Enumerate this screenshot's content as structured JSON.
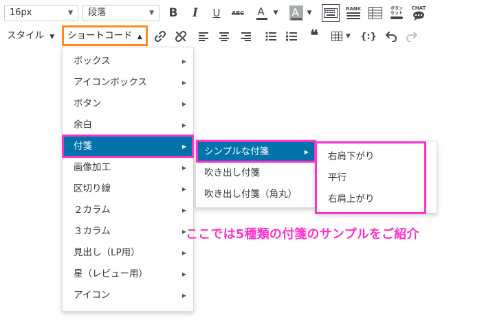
{
  "toolbar": {
    "font_size_select": "16px",
    "block_format_select": "段落",
    "styles_label": "スタイル",
    "shortcode_label": "ショートコード",
    "buttons": {
      "bold": "B",
      "italic": "I",
      "underline": "U",
      "strikethrough": "ABC",
      "text_color": "A",
      "background_color": "A",
      "rank_label": "RANK",
      "button_set_label_top": "ボタン",
      "button_set_label_bottom": "セット",
      "chat_label": "CHAT"
    },
    "icons": [
      "keyboard-icon",
      "ranking-icon",
      "table-icon",
      "button-set-icon",
      "chat-bubble-icon",
      "link-icon",
      "unlink-icon",
      "align-left-icon",
      "align-center-icon",
      "align-right-icon",
      "bullet-list-icon",
      "numbered-list-icon",
      "blockquote-icon",
      "table-insert-icon",
      "shortcode-icon",
      "undo-icon",
      "redo-icon"
    ]
  },
  "menu": {
    "items": [
      {
        "label": "ボックス"
      },
      {
        "label": "アイコンボックス"
      },
      {
        "label": "ボタン"
      },
      {
        "label": "余白"
      },
      {
        "label": "付箋",
        "active": true
      },
      {
        "label": "画像加工"
      },
      {
        "label": "区切り線"
      },
      {
        "label": "２カラム"
      },
      {
        "label": "３カラム"
      },
      {
        "label": "見出し（LP用）"
      },
      {
        "label": "星（レビュー用）"
      },
      {
        "label": "アイコン"
      }
    ]
  },
  "submenu": {
    "items": [
      {
        "label": "シンプルな付箋",
        "active": true
      },
      {
        "label": "吹き出し付箋"
      },
      {
        "label": "吹き出し付箋（角丸）"
      }
    ]
  },
  "subsubmenu": {
    "items": [
      {
        "label": "右肩下がり"
      },
      {
        "label": "平行"
      },
      {
        "label": "右肩上がり"
      }
    ]
  },
  "annotation": {
    "caption": "ここでは5種類の付箋のサンプルをご紹介",
    "highlight_color": "#ff33cc",
    "shortcode_highlight_color": "#ff8c1a"
  },
  "colors": {
    "active_item": "#0073aa",
    "icon": "#40464d"
  }
}
